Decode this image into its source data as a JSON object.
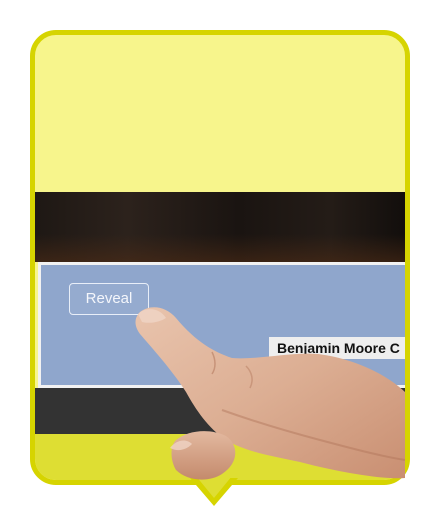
{
  "panel": {
    "reveal_label": "Reveal",
    "name_text": "Benjamin Moore C"
  },
  "colors": {
    "bubble_fill": "#f7f58c",
    "bubble_border": "#d6d400",
    "panel_fill": "#8fa6cc",
    "bar_fill": "#333333",
    "bottom_fill": "#dede33"
  },
  "icons": {
    "hand": "pointing-hand-icon"
  }
}
